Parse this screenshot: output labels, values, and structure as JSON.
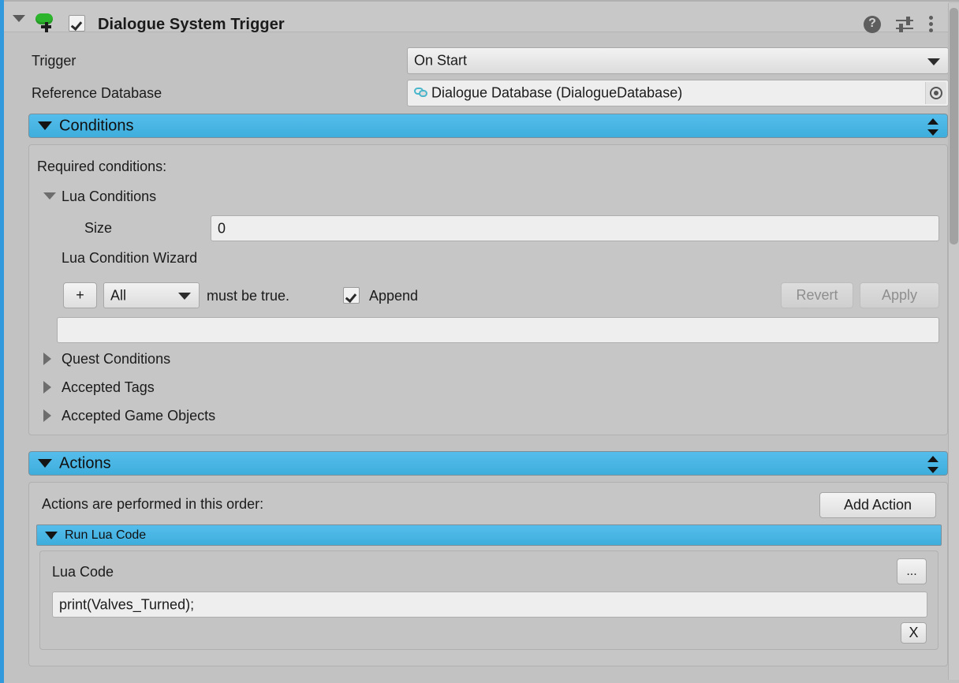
{
  "component": {
    "title": "Dialogue System Trigger",
    "enabled_checkbox": true,
    "foldout_expanded": true,
    "icon": "dialogue-system-trigger-icon",
    "header_icons": [
      {
        "name": "help-icon",
        "glyph": "?"
      },
      {
        "name": "preset-icon",
        "glyph": "sliders"
      },
      {
        "name": "more-menu-icon",
        "glyph": "kebab"
      }
    ]
  },
  "fields": {
    "trigger": {
      "label": "Trigger",
      "value": "On Start"
    },
    "reference_database": {
      "label": "Reference Database",
      "value": "Dialogue Database (DialogueDatabase)",
      "icon": "dialogue-database-icon"
    }
  },
  "conditions": {
    "header": "Conditions",
    "expanded": true,
    "required_label": "Required conditions:",
    "lua_conditions": {
      "label": "Lua Conditions",
      "expanded": true,
      "size_label": "Size",
      "size_value": "0"
    },
    "wizard": {
      "label": "Lua Condition Wizard",
      "add_button": "+",
      "mode_value": "All",
      "must_be_true_label": "must be true.",
      "append_label": "Append",
      "append_checked": true,
      "revert_button": "Revert",
      "apply_button": "Apply",
      "revert_disabled": true,
      "apply_disabled": true,
      "code_value": ""
    },
    "foldouts": [
      {
        "label": "Quest Conditions",
        "expanded": false
      },
      {
        "label": "Accepted Tags",
        "expanded": false
      },
      {
        "label": "Accepted Game Objects",
        "expanded": false
      }
    ]
  },
  "actions": {
    "header": "Actions",
    "expanded": true,
    "order_label": "Actions are performed in this order:",
    "add_action_button": "Add Action",
    "items": [
      {
        "header": "Run Lua Code",
        "expanded": true,
        "field_label": "Lua Code",
        "field_value": "print(Valves_Turned);",
        "ellipsis_button": "...",
        "remove_button": "X"
      }
    ]
  },
  "colors": {
    "window_background": "#c2c2c2",
    "header_background": "#c8c8c8",
    "section_blue": "#45b2e0",
    "selection_strip": "#3399dd",
    "component_icon_green": "#2cb42c",
    "field_background": "#eeeeee",
    "database_icon_cyan": "#49b6cc"
  }
}
